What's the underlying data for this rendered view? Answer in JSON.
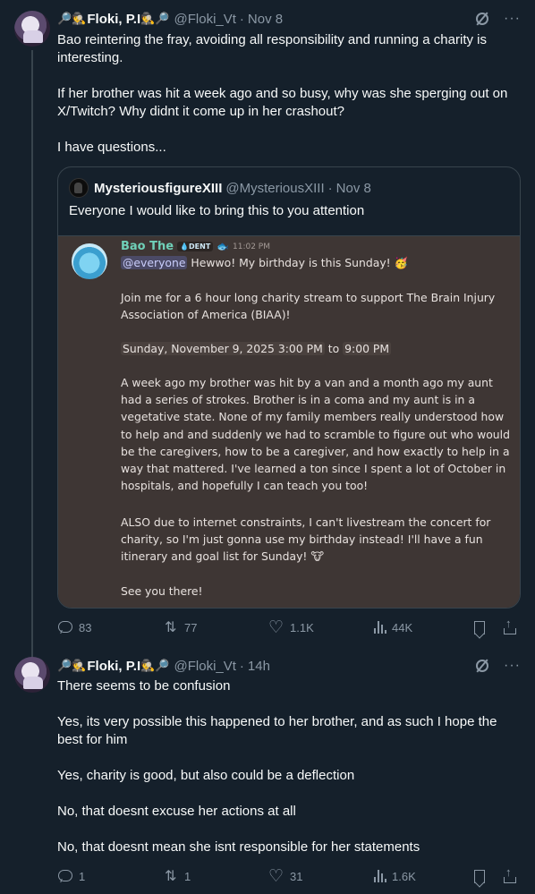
{
  "tweets": [
    {
      "author": {
        "emoji_prefix": "🔎🕵",
        "name": "Floki, P.I",
        "emoji_suffix": "🕵🔎",
        "handle": "@Floki_Vt",
        "time": "Nov 8"
      },
      "paragraphs": [
        "Bao reintering the fray, avoiding all responsibility and running a charity is interesting.",
        "If her brother was hit a week ago and so busy, why was she sperging out on X/Twitch? Why didnt it come up in her crashout?",
        "I have questions..."
      ],
      "quote": {
        "name": "MysteriousfigureXIII",
        "handle": "@MysteriousXIII",
        "time": "Nov 8",
        "text": "Everyone I would like to bring this to you attention",
        "image": {
          "username": "Bao The",
          "tag": "💧DENT",
          "time": "11:02 PM",
          "mention": "@everyone",
          "line1": " Hewwo! My birthday is this Sunday! 🥳",
          "para2": "Join me for a 6 hour long charity stream to support The Brain Injury Association of America (BIAA)!",
          "date_start": "Sunday, November 9, 2025 3:00 PM",
          "date_to": "to",
          "date_end": "9:00 PM",
          "para4": "A week ago my brother was hit by a van and a month ago my aunt had a series of strokes. Brother is in a coma and my aunt is in a vegetative state. None of my family members really understood how to help and and suddenly we had to scramble to figure out who would be the caregivers, how to be a caregiver, and how exactly to help in a way that mattered. I've learned a ton since I spent a lot of October in hospitals, and hopefully I can teach you too!",
          "para5": "ALSO due to internet constraints, I can't livestream the concert for charity, so I'm just gonna use my birthday instead! I'll have a fun itinerary and goal list for Sunday! 🐮",
          "para6": "See you there!"
        }
      },
      "actions": {
        "replies": "83",
        "reposts": "77",
        "likes": "1.1K",
        "views": "44K"
      }
    },
    {
      "author": {
        "emoji_prefix": "🔎🕵",
        "name": "Floki, P.I",
        "emoji_suffix": "🕵🔎",
        "handle": "@Floki_Vt",
        "time": "14h"
      },
      "paragraphs": [
        "There seems to be confusion",
        "Yes, its very possible this happened to her brother, and as such I hope the best for him",
        "Yes, charity is good, but also could be a deflection",
        "No, that doesnt excuse her actions at all",
        "No, that doesnt mean she isnt responsible for her statements"
      ],
      "actions": {
        "replies": "1",
        "reposts": "1",
        "likes": "31",
        "views": "1.6K"
      }
    }
  ],
  "icons": [
    "grok-icon",
    "more-icon",
    "reply-icon",
    "repost-icon",
    "like-icon",
    "views-icon",
    "bookmark-icon",
    "share-icon"
  ],
  "colors": {
    "background": "#15202b",
    "text": "#f7f9f9",
    "muted": "#8b98a5",
    "border": "#38444d",
    "discord_bg": "#3e3634",
    "discord_name": "#6fd0b8"
  }
}
